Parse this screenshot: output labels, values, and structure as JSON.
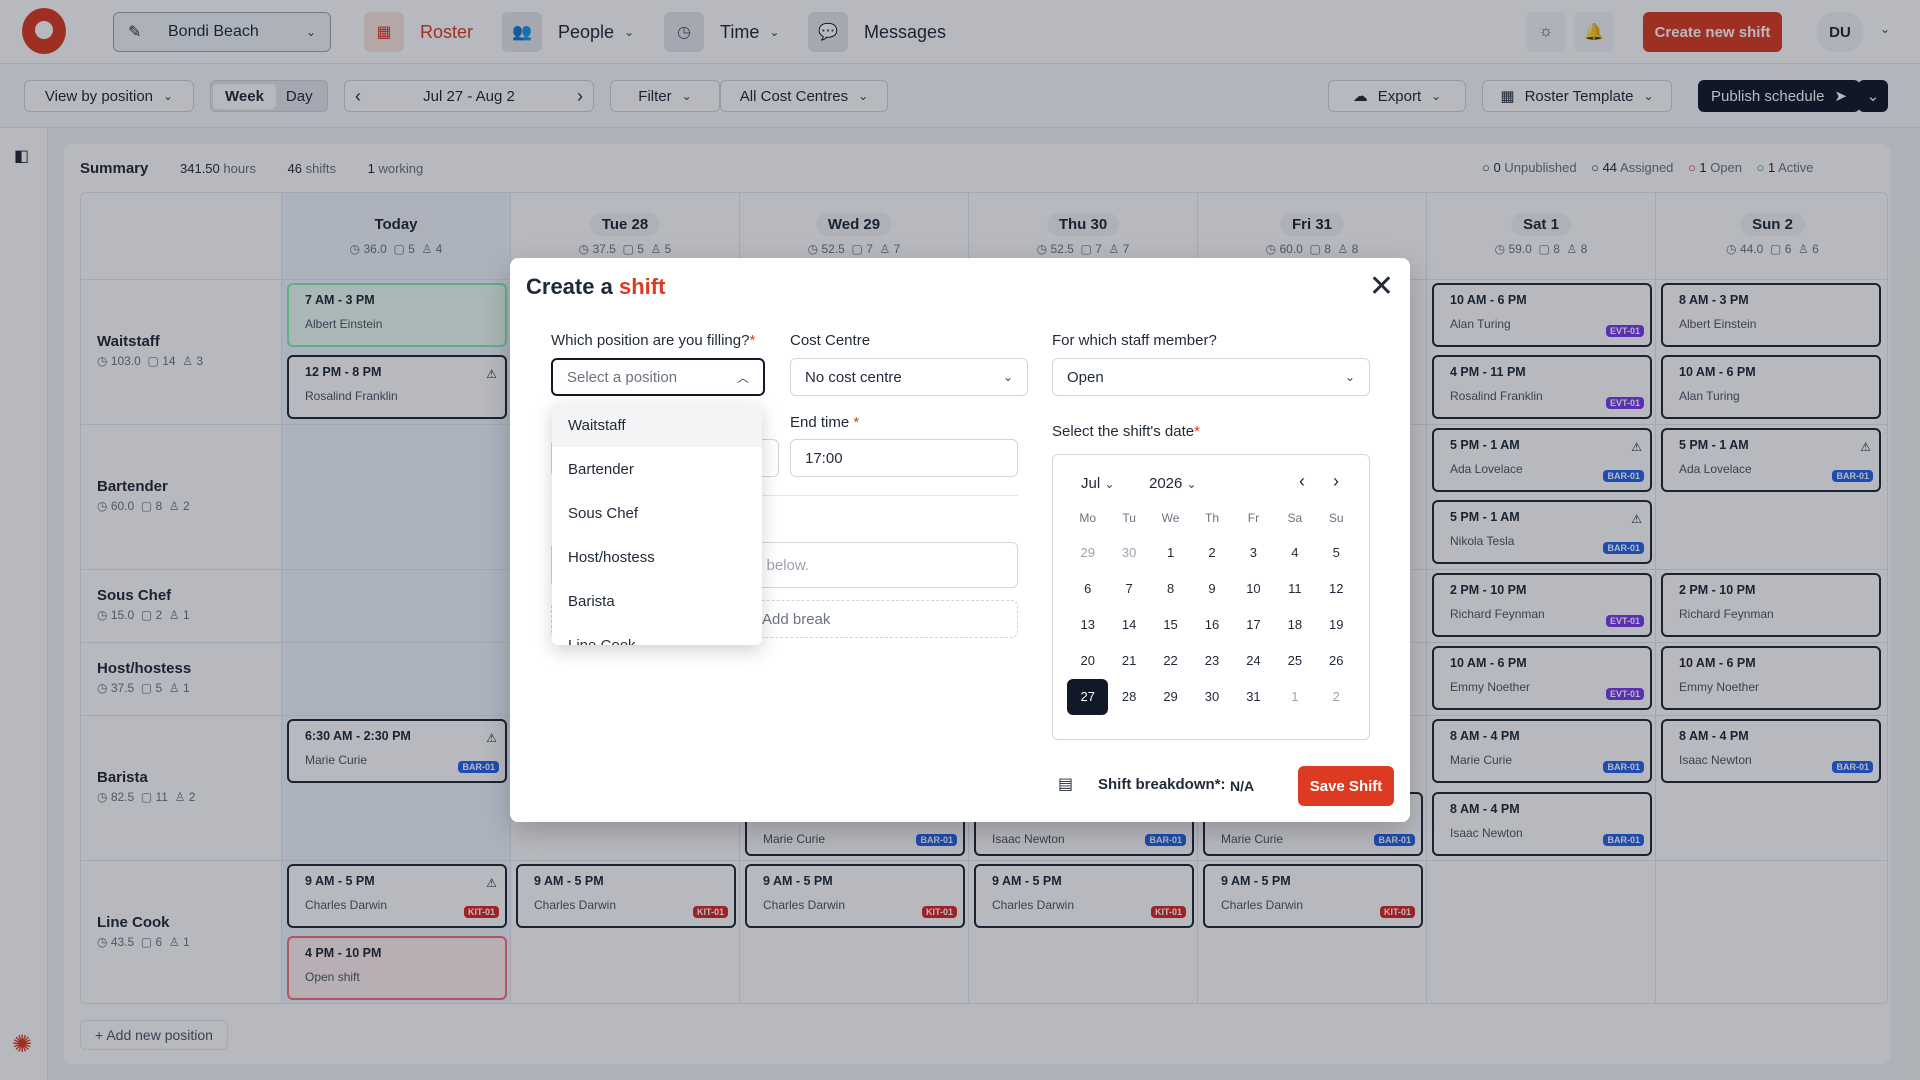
{
  "nav": {
    "location": "Bondi Beach",
    "roster": "Roster",
    "people": "People",
    "time": "Time",
    "messages": "Messages",
    "create": "Create new shift",
    "avatar": "DU"
  },
  "toolbar": {
    "view": "View by position",
    "week": "Week",
    "day": "Day",
    "range": "Jul 27 - Aug 2",
    "filter": "Filter",
    "cost": "All Cost Centres",
    "export": "Export",
    "template": "Roster Template",
    "publish": "Publish schedule"
  },
  "summary": {
    "label": "Summary",
    "hours": "341.50",
    "hours_u": "hours",
    "shifts": "46",
    "shifts_u": "shifts",
    "working": "1",
    "working_u": "working",
    "unpub": "0",
    "unpub_l": "Unpublished",
    "assigned": "44",
    "assigned_l": "Assigned",
    "open": "1",
    "open_l": "Open",
    "active": "1",
    "active_l": "Active"
  },
  "days": [
    {
      "label": "Today",
      "hrs": "36.0",
      "sh": "5",
      "pp": "4"
    },
    {
      "label": "Tue 28",
      "hrs": "37.5",
      "sh": "5",
      "pp": "5"
    },
    {
      "label": "Wed 29",
      "hrs": "52.5",
      "sh": "7",
      "pp": "7"
    },
    {
      "label": "Thu 30",
      "hrs": "52.5",
      "sh": "7",
      "pp": "7"
    },
    {
      "label": "Fri 31",
      "hrs": "60.0",
      "sh": "8",
      "pp": "8"
    },
    {
      "label": "Sat 1",
      "hrs": "59.0",
      "sh": "8",
      "pp": "8"
    },
    {
      "label": "Sun 2",
      "hrs": "44.0",
      "sh": "6",
      "pp": "6"
    }
  ],
  "positions": [
    {
      "name": "Waitstaff",
      "hrs": "103.0",
      "sh": "14",
      "pp": "3"
    },
    {
      "name": "Bartender",
      "hrs": "60.0",
      "sh": "8",
      "pp": "2"
    },
    {
      "name": "Sous Chef",
      "hrs": "15.0",
      "sh": "2",
      "pp": "1"
    },
    {
      "name": "Host/hostess",
      "hrs": "37.5",
      "sh": "5",
      "pp": "1"
    },
    {
      "name": "Barista",
      "hrs": "82.5",
      "sh": "11",
      "pp": "2"
    },
    {
      "name": "Line Cook",
      "hrs": "43.5",
      "sh": "6",
      "pp": "1"
    }
  ],
  "shifts": {
    "w1": {
      "t": "7 AM - 3 PM",
      "n": "Albert Einstein"
    },
    "w2": {
      "t": "12 PM - 8 PM",
      "n": "Rosalind Franklin"
    },
    "b1": {
      "t": "6:30 AM - 2:30 PM",
      "n": "Marie Curie",
      "tag": "BAR-01"
    },
    "l1": {
      "t": "9 AM - 5 PM",
      "n": "Charles Darwin",
      "tag": "KIT-01"
    },
    "l2": {
      "t": "4 PM - 10 PM",
      "n": "Open shift"
    },
    "tl": {
      "t": "9 AM - 5 PM",
      "n": "Charles Darwin",
      "tag": "KIT-01"
    },
    "wl": {
      "t": "9 AM - 5 PM",
      "n": "Charles Darwin",
      "tag": "KIT-01"
    },
    "wb": {
      "n": "Marie Curie",
      "tag": "BAR-01"
    },
    "thl": {
      "t": "9 AM - 5 PM",
      "n": "Charles Darwin",
      "tag": "KIT-01"
    },
    "thb": {
      "n": "Isaac Newton",
      "tag": "BAR-01"
    },
    "fl": {
      "t": "9 AM - 5 PM",
      "n": "Charles Darwin",
      "tag": "KIT-01"
    },
    "fb": {
      "n": "Marie Curie",
      "tag": "BAR-01"
    },
    "s1": {
      "t": "10 AM - 6 PM",
      "n": "Alan Turing",
      "tag": "EVT-01"
    },
    "s2": {
      "t": "4 PM - 11 PM",
      "n": "Rosalind Franklin",
      "tag": "EVT-01"
    },
    "s3": {
      "t": "5 PM - 1 AM",
      "n": "Ada Lovelace",
      "tag": "BAR-01"
    },
    "s4": {
      "t": "5 PM - 1 AM",
      "n": "Nikola Tesla",
      "tag": "BAR-01"
    },
    "s5": {
      "t": "2 PM - 10 PM",
      "n": "Richard Feynman",
      "tag": "EVT-01"
    },
    "s6": {
      "t": "10 AM - 6 PM",
      "n": "Emmy Noether",
      "tag": "EVT-01"
    },
    "s7": {
      "t": "8 AM - 4 PM",
      "n": "Marie Curie",
      "tag": "BAR-01"
    },
    "s8": {
      "t": "8 AM - 4 PM",
      "n": "Isaac Newton",
      "tag": "BAR-01"
    },
    "u1": {
      "t": "8 AM - 3 PM",
      "n": "Albert Einstein"
    },
    "u2": {
      "t": "10 AM - 6 PM",
      "n": "Alan Turing"
    },
    "u3": {
      "t": "5 PM - 1 AM",
      "n": "Ada Lovelace",
      "tag": "BAR-01"
    },
    "u4": {
      "t": "2 PM - 10 PM",
      "n": "Richard Feynman"
    },
    "u5": {
      "t": "10 AM - 6 PM",
      "n": "Emmy Noether"
    },
    "u6": {
      "t": "8 AM - 4 PM",
      "n": "Isaac Newton",
      "tag": "BAR-01"
    }
  },
  "addpos": "+ Add new position",
  "modal": {
    "title_a": "Create a",
    "title_b": "shift",
    "pos_label": "Which position are you filling?",
    "pos_placeholder": "Select a position",
    "cost_label": "Cost Centre",
    "cost_value": "No cost centre",
    "staff_label": "For which staff member?",
    "staff_value": "Open",
    "end_label": "End time",
    "end_value": "17:00",
    "date_label": "Select the shift's date",
    "desc_frag": "e below.",
    "break": "Add break",
    "breakdown_label": "Shift breakdown*:",
    "breakdown_value": "N/A",
    "save": "Save Shift",
    "options": [
      "Waitstaff",
      "Bartender",
      "Sous Chef",
      "Host/hostess",
      "Barista",
      "Line Cook"
    ]
  },
  "calendar": {
    "month": "Jul",
    "year": "2026",
    "dow": [
      "Mo",
      "Tu",
      "We",
      "Th",
      "Fr",
      "Sa",
      "Su"
    ],
    "days": [
      "29",
      "30",
      "1",
      "2",
      "3",
      "4",
      "5",
      "6",
      "7",
      "8",
      "9",
      "10",
      "11",
      "12",
      "13",
      "14",
      "15",
      "16",
      "17",
      "18",
      "19",
      "20",
      "21",
      "22",
      "23",
      "24",
      "25",
      "26",
      "27",
      "28",
      "29",
      "30",
      "31",
      "1",
      "2"
    ],
    "selected": "27"
  }
}
